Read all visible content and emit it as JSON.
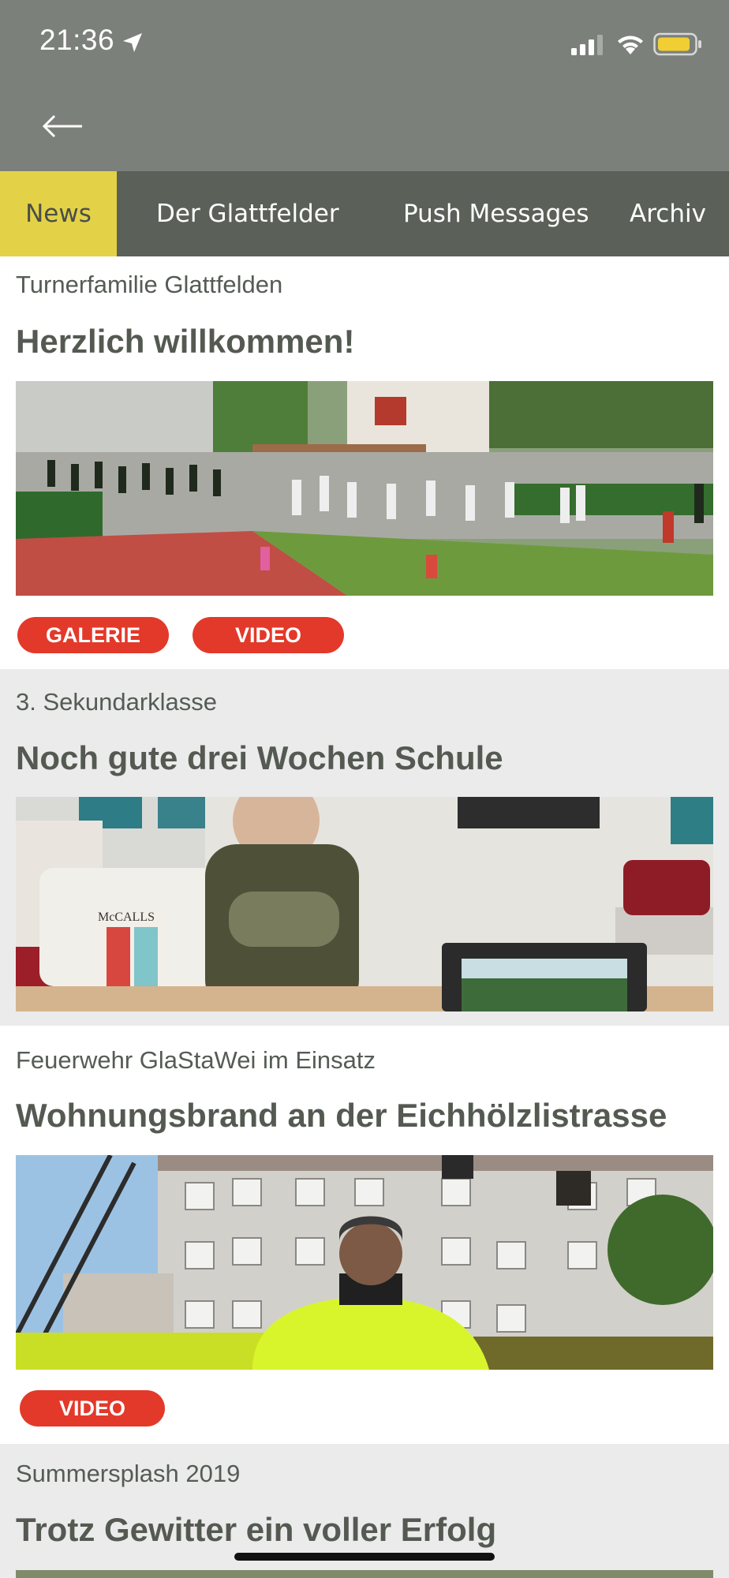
{
  "status_bar": {
    "time": "21:36"
  },
  "nav": {
    "tabs": [
      {
        "label": "News",
        "active": true
      },
      {
        "label": "Der Glattfelder",
        "active": false
      },
      {
        "label": "Push Messages",
        "active": false
      },
      {
        "label": "Archiv",
        "active": false
      }
    ]
  },
  "articles": [
    {
      "kicker": "Turnerfamilie Glattfelden",
      "title": "Herzlich willkommen!",
      "buttons": [
        "GALERIE",
        "VIDEO"
      ]
    },
    {
      "kicker": "3. Sekundarklasse",
      "title": "Noch gute drei Wochen Schule",
      "buttons": []
    },
    {
      "kicker": "Feuerwehr GlaStaWei im Einsatz",
      "title": "Wohnungsbrand an der Eichhölzlistrasse",
      "buttons": [
        "VIDEO"
      ]
    },
    {
      "kicker": "Summersplash 2019",
      "title": "Trotz Gewitter ein voller Erfolg",
      "buttons": []
    }
  ],
  "photo_text": {
    "pattern_brand": "McCALLS"
  },
  "colors": {
    "header_bg": "#7c807b",
    "tabbar_bg": "#5b6159",
    "active_tab_bg": "#e3d247",
    "pill_bg": "#e3392a",
    "alt_section_bg": "#ebebeb",
    "title_text": "#545a52"
  },
  "icons": [
    "location-arrow-icon",
    "signal-icon",
    "wifi-icon",
    "battery-icon",
    "back-arrow-icon"
  ]
}
